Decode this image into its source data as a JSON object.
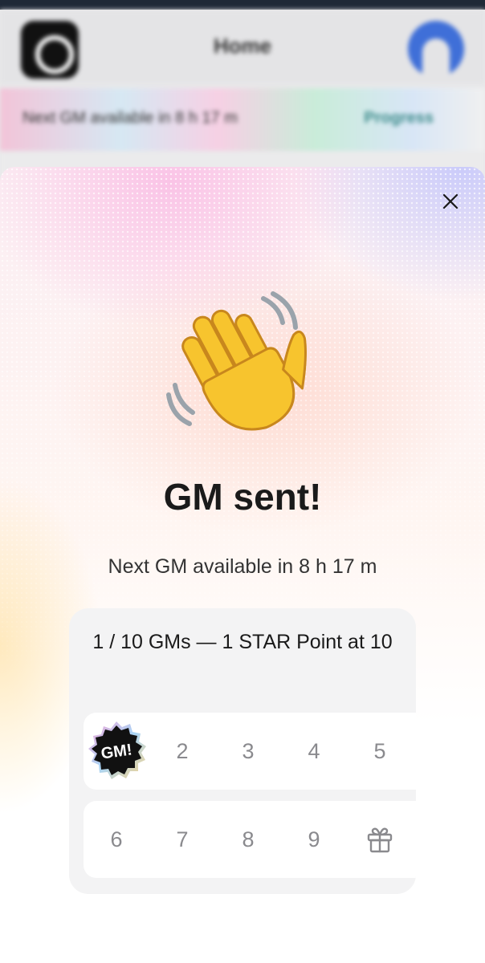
{
  "background_app": {
    "title": "Home",
    "banner_text": "Next GM available in 8 h 17 m",
    "banner_link": "Progress"
  },
  "sheet": {
    "close_icon": "close-icon",
    "hero_icon": "waving-hand-icon",
    "headline": "GM sent!",
    "subtext": "Next GM available in 8 h 17 m",
    "progress": {
      "title": "1 / 10 GMs — 1 STAR Point at 10",
      "completed": 1,
      "total": 10,
      "badge_label": "GM!",
      "steps_row1": [
        "2",
        "3",
        "4",
        "5"
      ],
      "steps_row2": [
        "6",
        "7",
        "8",
        "9"
      ],
      "reward_icon": "gift-icon"
    }
  },
  "colors": {
    "headline": "#1a1a1a",
    "step_inactive": "#8a8a8e",
    "card_bg": "#f3f3f4"
  }
}
